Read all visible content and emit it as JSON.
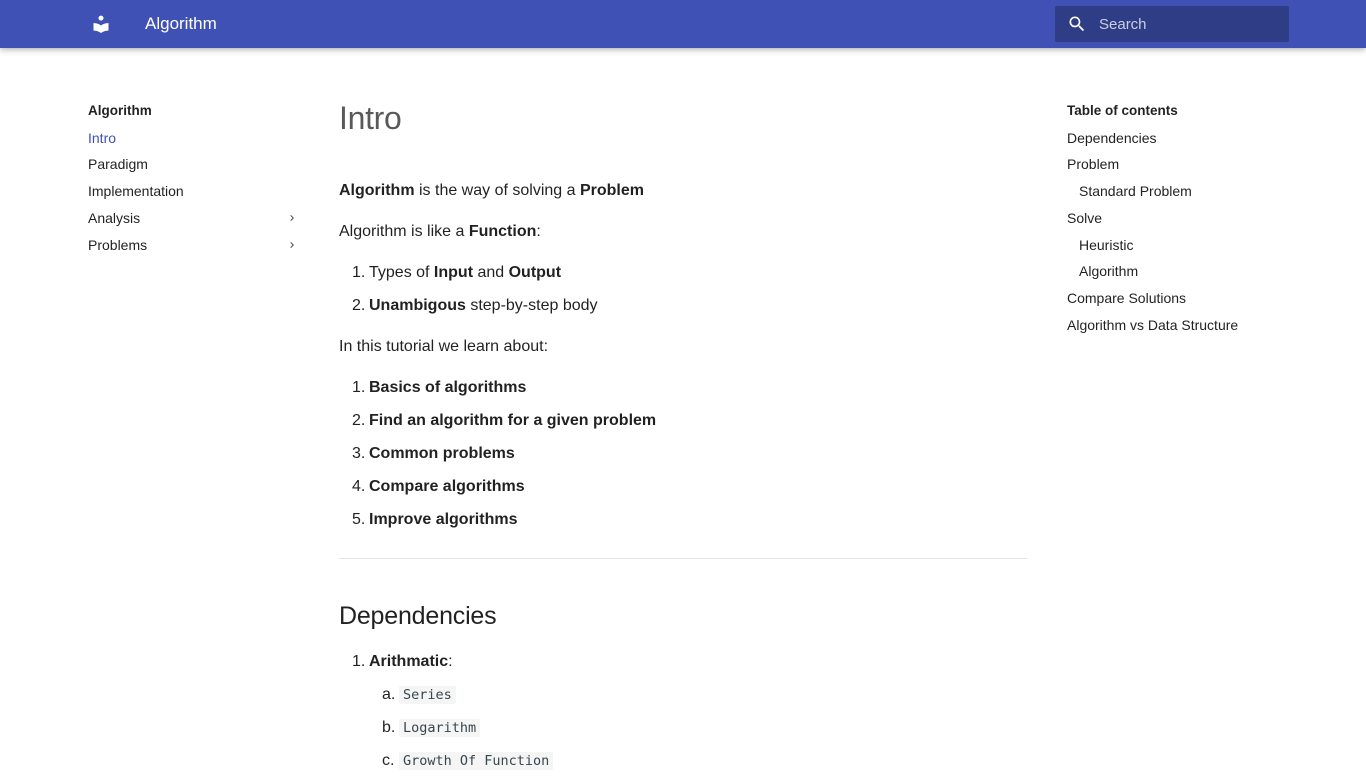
{
  "header": {
    "logo_icon": "book-reader-icon",
    "title": "Algorithm",
    "search_placeholder": "Search",
    "search_icon": "search-icon",
    "colors": {
      "primary": "#4051b5",
      "accent": "#4051b5"
    }
  },
  "nav": {
    "title": "Algorithm",
    "items": [
      {
        "label": "Intro",
        "active": true,
        "expandable": false
      },
      {
        "label": "Paradigm",
        "active": false,
        "expandable": false
      },
      {
        "label": "Implementation",
        "active": false,
        "expandable": false
      },
      {
        "label": "Analysis",
        "active": false,
        "expandable": true
      },
      {
        "label": "Problems",
        "active": false,
        "expandable": true
      }
    ]
  },
  "content": {
    "title": "Intro",
    "p1": {
      "a": "Algorithm",
      "b": " is the way of solving a ",
      "c": "Problem"
    },
    "p2": {
      "a": "Algorithm is like a ",
      "b": "Function",
      "c": ":"
    },
    "list1": [
      {
        "num": "1.",
        "a": "Types of ",
        "b": "Input",
        "c": " and ",
        "d": "Output"
      },
      {
        "num": "2.",
        "a": "Unambigous",
        "b": " step-by-step body"
      }
    ],
    "p3": "In this tutorial we learn about:",
    "list2": [
      {
        "num": "1.",
        "text": "Basics of algorithms"
      },
      {
        "num": "2.",
        "text": "Find an algorithm for a given problem"
      },
      {
        "num": "3.",
        "text": "Common problems"
      },
      {
        "num": "4.",
        "text": "Compare algorithms"
      },
      {
        "num": "5.",
        "text": "Improve algorithms"
      }
    ],
    "h2": "Dependencies",
    "dep": {
      "num": "1.",
      "label": "Arithmatic",
      "colon": ":"
    },
    "deps_sub": [
      {
        "num": "a.",
        "code": "Series"
      },
      {
        "num": "b.",
        "code": "Logarithm"
      },
      {
        "num": "c.",
        "code": "Growth Of Function"
      }
    ]
  },
  "toc": {
    "title": "Table of contents",
    "items": [
      {
        "label": "Dependencies",
        "level": 1
      },
      {
        "label": "Problem",
        "level": 1
      },
      {
        "label": "Standard Problem",
        "level": 2
      },
      {
        "label": "Solve",
        "level": 1
      },
      {
        "label": "Heuristic",
        "level": 2
      },
      {
        "label": "Algorithm",
        "level": 2
      },
      {
        "label": "Compare Solutions",
        "level": 1
      },
      {
        "label": "Algorithm vs Data Structure",
        "level": 1
      }
    ]
  }
}
